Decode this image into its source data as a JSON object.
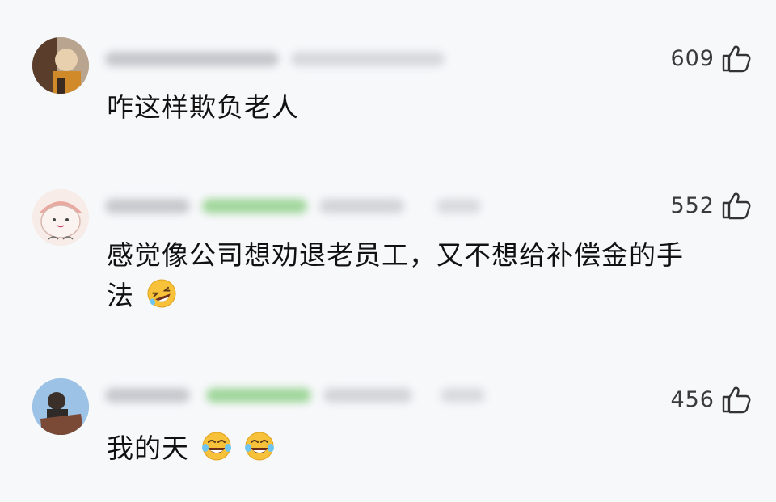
{
  "comments": [
    {
      "likes": "609",
      "text": "咋这样欺负老人",
      "emojis": []
    },
    {
      "likes": "552",
      "text_line1": "感觉像公司想劝退老员工，又不想给补偿金的手",
      "text_line2": "法",
      "emojis": [
        "rofl-emoji"
      ]
    },
    {
      "likes": "456",
      "text": "我的天",
      "emojis": [
        "crying-laughing-emoji",
        "crying-laughing-emoji"
      ]
    }
  ],
  "colors": {
    "background": "#f7f8fa",
    "name_blur_gray": "#c9cbd0",
    "name_blur_green": "#8fd18a",
    "text": "#111111",
    "like_count": "#3a3a3a"
  }
}
